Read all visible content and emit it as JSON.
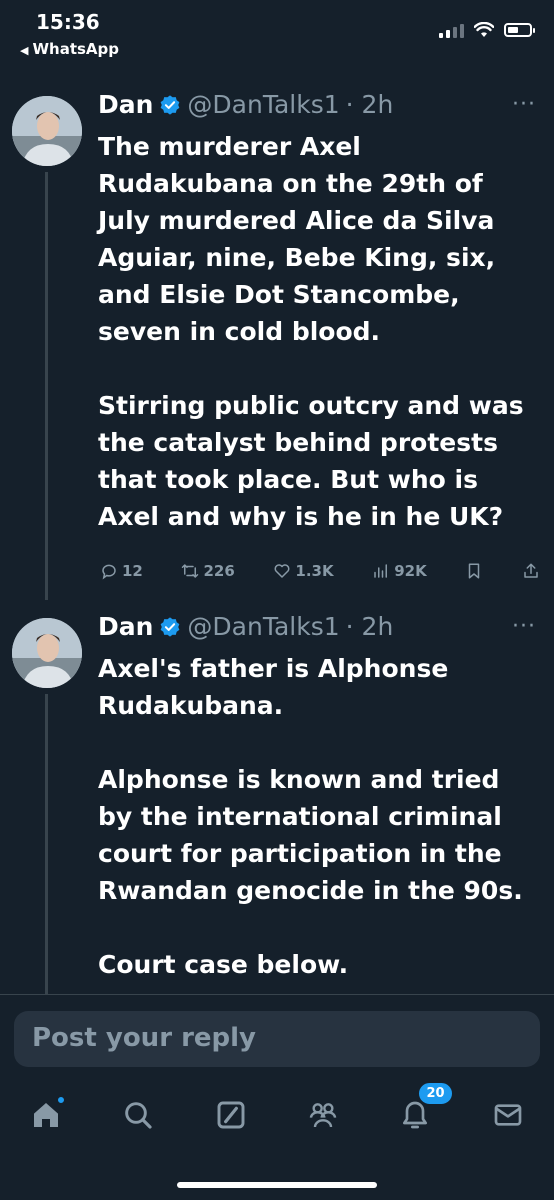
{
  "status_bar": {
    "time": "15:36",
    "back_label": "WhatsApp"
  },
  "tweets": [
    {
      "name": "Dan",
      "handle": "@DanTalks1",
      "time": "· 2h",
      "paragraphs": [
        "The murderer Axel Rudakubana on the 29th of July murdered Alice da Silva Aguiar, nine, Bebe King, six, and Elsie Dot Stancombe, seven in cold blood.",
        "Stirring public outcry and was the catalyst behind protests that took place. But who is Axel and why is he in he UK?"
      ],
      "stats": {
        "replies": "12",
        "reposts": "226",
        "likes": "1.3K",
        "views": "92K"
      }
    },
    {
      "name": "Dan",
      "handle": "@DanTalks1",
      "time": "· 2h",
      "paragraphs": [
        "Axel's father is Alphonse Rudakubana.",
        "Alphonse is known and tried by the international criminal court for participation in the Rwandan genocide in the 90s.",
        "Court case below."
      ]
    }
  ],
  "reply": {
    "placeholder": "Post your reply"
  },
  "tabbar": {
    "notifications_count": "20",
    "items": [
      "home-icon",
      "search-icon",
      "grok-icon",
      "communities-icon",
      "notifications-icon",
      "messages-icon"
    ]
  },
  "colors": {
    "background": "#15202b",
    "accent": "#1d9bf0",
    "muted": "#8899a6"
  }
}
